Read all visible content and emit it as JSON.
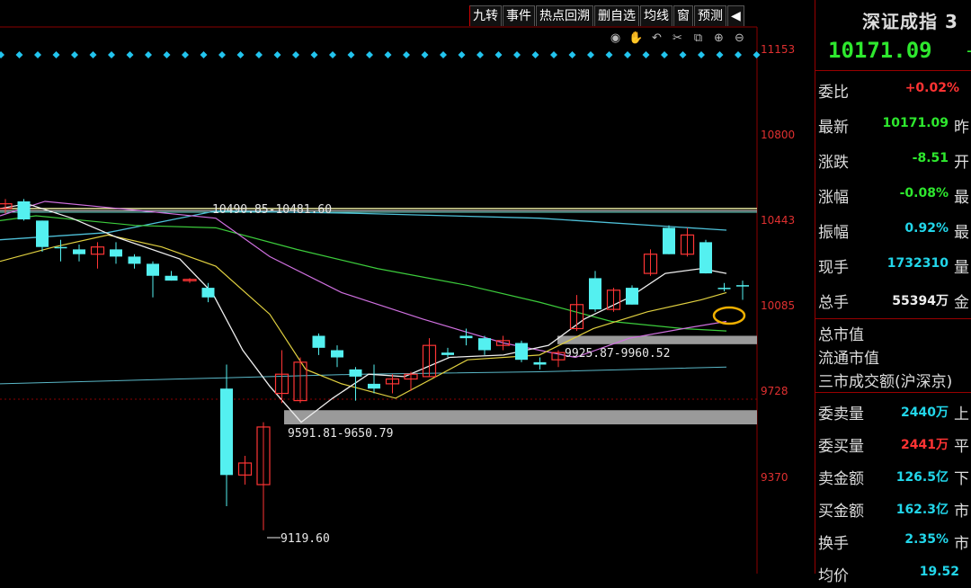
{
  "toolbar": {
    "items": [
      "九转",
      "事件",
      "热点回溯",
      "删自选",
      "均线",
      "窗",
      "预测"
    ],
    "window_controls": [
      "eye-icon",
      "hand-icon",
      "undo-icon",
      "scissors-icon",
      "copy-icon",
      "zoom-in-icon",
      "zoom-out-icon"
    ]
  },
  "chart_data": {
    "type": "candlestick",
    "y_ticks": [
      "11153",
      "10800",
      "10443",
      "10085",
      "9728",
      "9370"
    ],
    "annotations": {
      "upper_gap": "10490.85-10481.60",
      "low_point": "9591.81-9650.79",
      "mid_gap": "9925.87-9960.52",
      "min_label": "9119.60"
    },
    "candles": [
      {
        "o": 10490,
        "h": 10530,
        "l": 10470,
        "c": 10510
      },
      {
        "o": 10520,
        "h": 10530,
        "l": 10440,
        "c": 10445
      },
      {
        "o": 10440,
        "h": 10440,
        "l": 10310,
        "c": 10330
      },
      {
        "o": 10330,
        "h": 10360,
        "l": 10270,
        "c": 10330
      },
      {
        "o": 10320,
        "h": 10340,
        "l": 10270,
        "c": 10300
      },
      {
        "o": 10300,
        "h": 10350,
        "l": 10240,
        "c": 10330
      },
      {
        "o": 10320,
        "h": 10350,
        "l": 10260,
        "c": 10290
      },
      {
        "o": 10290,
        "h": 10300,
        "l": 10240,
        "c": 10260
      },
      {
        "o": 10260,
        "h": 10270,
        "l": 10120,
        "c": 10210
      },
      {
        "o": 10210,
        "h": 10230,
        "l": 10190,
        "c": 10190
      },
      {
        "o": 10190,
        "h": 10200,
        "l": 10180,
        "c": 10195
      },
      {
        "o": 10160,
        "h": 10180,
        "l": 10100,
        "c": 10120
      },
      {
        "o": 9740,
        "h": 9840,
        "l": 9250,
        "c": 9380
      },
      {
        "o": 9380,
        "h": 9460,
        "l": 9340,
        "c": 9430
      },
      {
        "o": 9340,
        "h": 9600,
        "l": 9150,
        "c": 9580
      },
      {
        "o": 9720,
        "h": 9900,
        "l": 9680,
        "c": 9800
      },
      {
        "o": 9690,
        "h": 9870,
        "l": 9680,
        "c": 9850
      },
      {
        "o": 9960,
        "h": 9970,
        "l": 9880,
        "c": 9910
      },
      {
        "o": 9900,
        "h": 9920,
        "l": 9830,
        "c": 9870
      },
      {
        "o": 9820,
        "h": 9830,
        "l": 9690,
        "c": 9790
      },
      {
        "o": 9760,
        "h": 9840,
        "l": 9720,
        "c": 9740
      },
      {
        "o": 9760,
        "h": 9800,
        "l": 9720,
        "c": 9780
      },
      {
        "o": 9780,
        "h": 9810,
        "l": 9730,
        "c": 9800
      },
      {
        "o": 9790,
        "h": 9950,
        "l": 9790,
        "c": 9920
      },
      {
        "o": 9890,
        "h": 9910,
        "l": 9870,
        "c": 9880
      },
      {
        "o": 9960,
        "h": 9990,
        "l": 9920,
        "c": 9950
      },
      {
        "o": 9950,
        "h": 9960,
        "l": 9880,
        "c": 9900
      },
      {
        "o": 9920,
        "h": 9960,
        "l": 9900,
        "c": 9940
      },
      {
        "o": 9930,
        "h": 9940,
        "l": 9850,
        "c": 9860
      },
      {
        "o": 9850,
        "h": 9870,
        "l": 9820,
        "c": 9840
      },
      {
        "o": 9860,
        "h": 9900,
        "l": 9830,
        "c": 9890
      },
      {
        "o": 9990,
        "h": 10130,
        "l": 9980,
        "c": 10090
      },
      {
        "o": 10200,
        "h": 10230,
        "l": 10060,
        "c": 10070
      },
      {
        "o": 10070,
        "h": 10160,
        "l": 10060,
        "c": 10150
      },
      {
        "o": 10160,
        "h": 10170,
        "l": 10090,
        "c": 10090
      },
      {
        "o": 10220,
        "h": 10320,
        "l": 10210,
        "c": 10300
      },
      {
        "o": 10410,
        "h": 10420,
        "l": 10300,
        "c": 10300
      },
      {
        "o": 10300,
        "h": 10410,
        "l": 10290,
        "c": 10380
      },
      {
        "o": 10350,
        "h": 10360,
        "l": 10220,
        "c": 10220
      },
      {
        "o": 10160,
        "h": 10180,
        "l": 10145,
        "c": 10160
      },
      {
        "o": 10171,
        "h": 10190,
        "l": 10110,
        "c": 10171
      }
    ]
  },
  "panel": {
    "title": "深证成指",
    "title_trail": "3",
    "price": "10171.09",
    "price_trail": "-",
    "rows1": [
      {
        "label": "委比",
        "value": "+0.02%",
        "color": "red",
        "trail": ""
      },
      {
        "label": "最新",
        "value": "10171.09",
        "color": "green",
        "trail": "昨"
      },
      {
        "label": "涨跌",
        "value": "-8.51",
        "color": "green",
        "trail": "开"
      },
      {
        "label": "涨幅",
        "value": "-0.08%",
        "color": "green",
        "trail": "最"
      },
      {
        "label": "振幅",
        "value": "0.92%",
        "color": "cyan",
        "trail": "最"
      },
      {
        "label": "现手",
        "value": "1732310",
        "color": "cyan",
        "trail": "量"
      },
      {
        "label": "总手",
        "value": "55394万",
        "color": "white",
        "trail": "金"
      }
    ],
    "lines": [
      "总市值",
      "流通市值",
      "三市成交额(沪深京)"
    ],
    "rows2": [
      {
        "label": "委卖量",
        "value": "2440万",
        "color": "cyan",
        "trail": "上"
      },
      {
        "label": "委买量",
        "value": "2441万",
        "color": "red",
        "trail": "平"
      },
      {
        "label": "卖金额",
        "value": "126.5亿",
        "color": "cyan",
        "trail": "下"
      },
      {
        "label": "买金额",
        "value": "162.3亿",
        "color": "cyan",
        "trail": "市"
      },
      {
        "label": "换手",
        "value": "2.35%",
        "color": "cyan",
        "trail": "市"
      },
      {
        "label": "均价",
        "value": "19.52",
        "color": "cyan",
        "trail": ""
      }
    ]
  }
}
